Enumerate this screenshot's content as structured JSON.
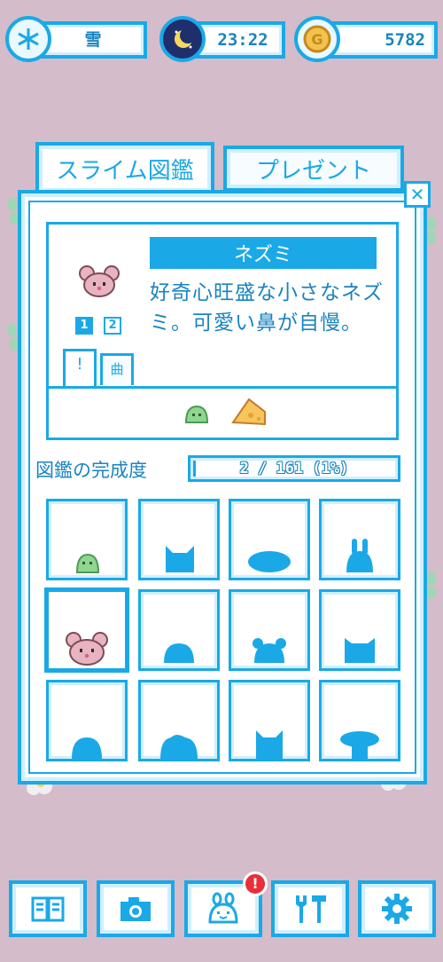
{
  "status_bar": {
    "weather": {
      "icon": "snowflake-icon",
      "label": "雪"
    },
    "clock": {
      "icon": "moon-icon",
      "time": "23:22"
    },
    "coins": {
      "icon": "coin-icon",
      "amount": "5782"
    }
  },
  "tabs": [
    {
      "label": "スライム図鑑",
      "active": true
    },
    {
      "label": "プレゼント",
      "active": false
    }
  ],
  "entry": {
    "name": "ネズミ",
    "description": "好奇心旺盛な小さなネズミ。可愛い鼻が自慢。",
    "pages": [
      "1",
      "2"
    ],
    "active_page": "1",
    "mini_tabs": [
      {
        "icon": "pin-icon",
        "glyph": "!"
      },
      {
        "icon": "music-icon",
        "glyph": "曲"
      }
    ],
    "favorite_foods": [
      "green-slime-icon",
      "cheese-icon"
    ]
  },
  "completion": {
    "label": "図鑑の完成度",
    "text": "2 / 161 (1%)",
    "fraction": 0.0124
  },
  "grid": [
    {
      "name": "green-slime",
      "discovered": true
    },
    {
      "name": "cat-silhouette",
      "discovered": false
    },
    {
      "name": "flat-blob-silhouette",
      "discovered": false
    },
    {
      "name": "rabbit-silhouette",
      "discovered": false
    },
    {
      "name": "mouse",
      "discovered": true,
      "selected": true
    },
    {
      "name": "round-blob-silhouette",
      "discovered": false
    },
    {
      "name": "bear-silhouette",
      "discovered": false
    },
    {
      "name": "cat2-silhouette",
      "discovered": false
    },
    {
      "name": "dome-silhouette",
      "discovered": false
    },
    {
      "name": "wide-blob-silhouette",
      "discovered": false
    },
    {
      "name": "fox-silhouette",
      "discovered": false
    },
    {
      "name": "mushroom-silhouette",
      "discovered": false
    }
  ],
  "nav": [
    {
      "name": "book-icon"
    },
    {
      "name": "camera-icon"
    },
    {
      "name": "slime-face-icon",
      "badge": "!"
    },
    {
      "name": "tools-icon"
    },
    {
      "name": "gear-icon"
    }
  ],
  "colors": {
    "accent": "#1aa9e6",
    "background": "#d4bccb",
    "slime_green": "#8fd68f",
    "mouse_pink": "#e8b4c0",
    "cheese": "#f6c65a",
    "badge_red": "#e8303a"
  }
}
